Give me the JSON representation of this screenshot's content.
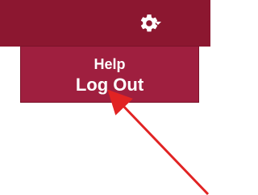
{
  "header": {
    "icons": {
      "gear": "gear-icon",
      "caret": "chevron-down-icon"
    },
    "colors": {
      "bar": "#8c1730",
      "dropdown": "#9f1f3f",
      "text": "#ffffff",
      "annotation_arrow": "#e12323"
    }
  },
  "dropdown": {
    "items": [
      {
        "label": "Help"
      },
      {
        "label": "Log Out"
      }
    ]
  }
}
